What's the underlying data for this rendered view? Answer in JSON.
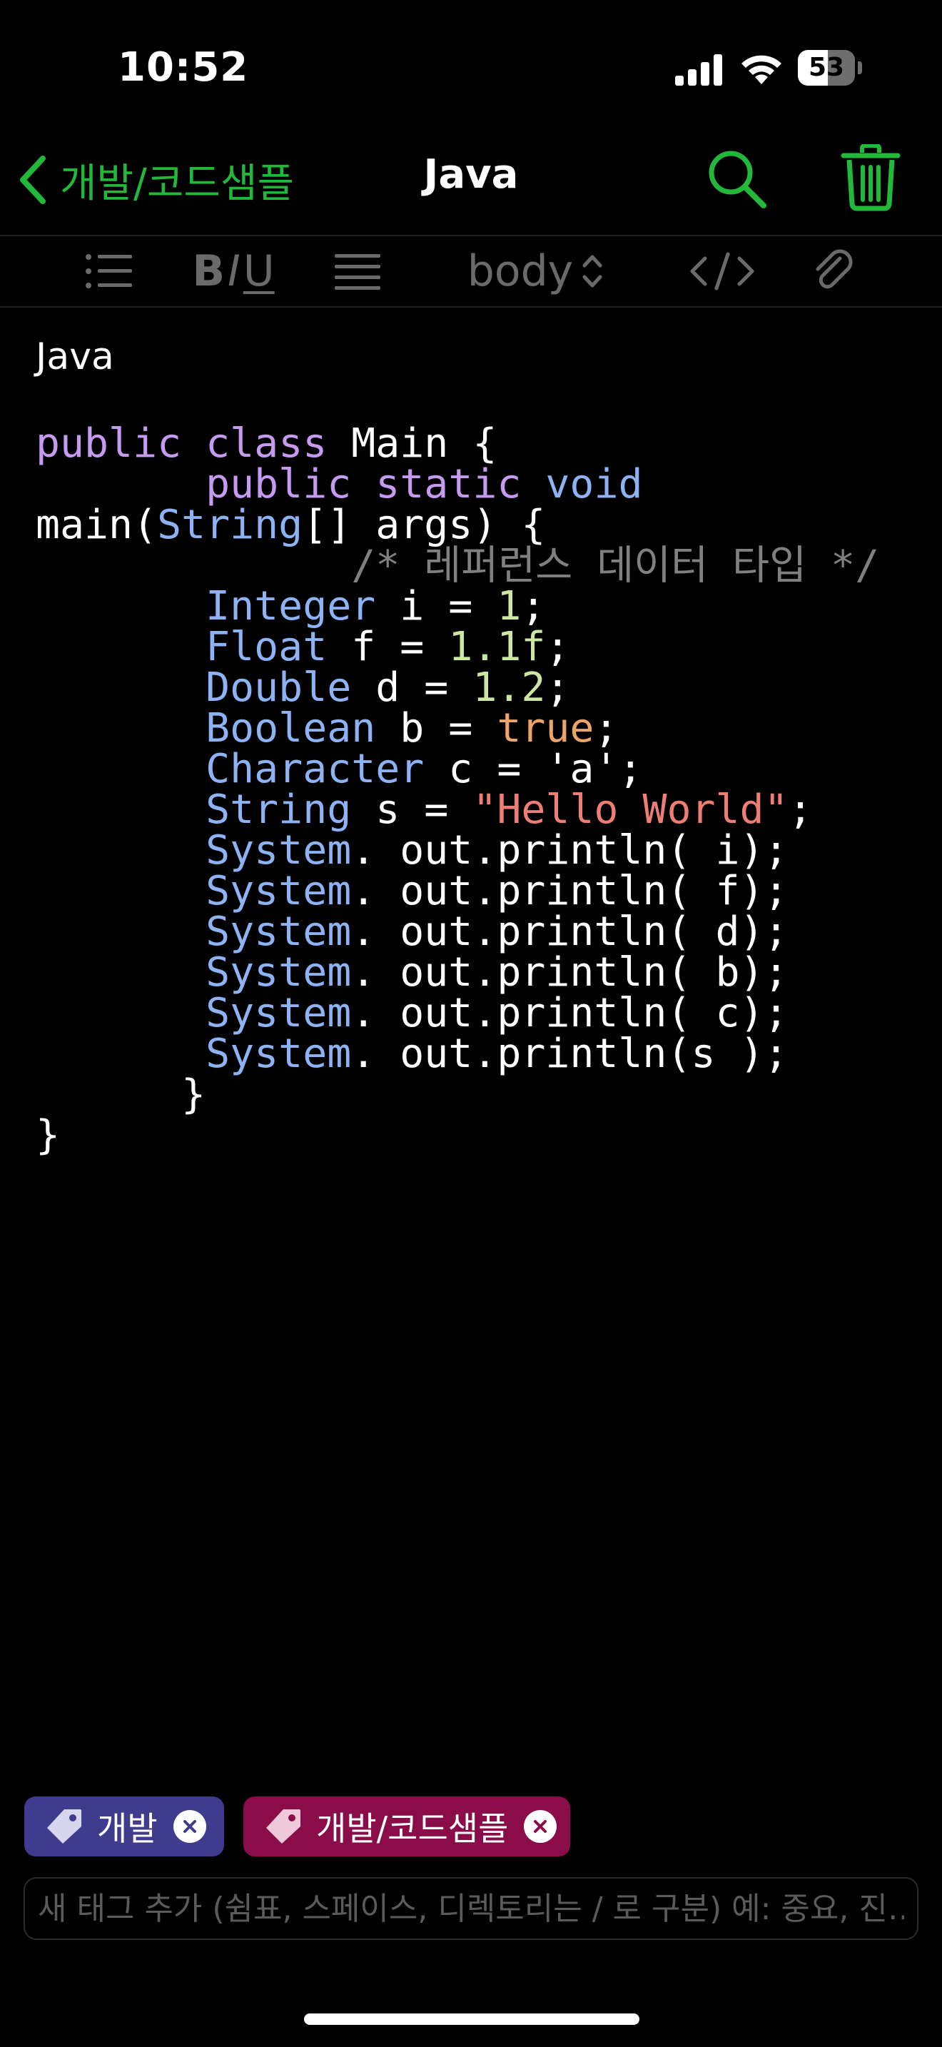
{
  "status_bar": {
    "time": "10:52",
    "battery_level": "53",
    "battery_fraction": 0.53
  },
  "nav": {
    "back_label": "개발/코드샘플",
    "title": "Java"
  },
  "toolbar": {
    "bold": "B",
    "italic": "I",
    "underline": "U",
    "text_style": "body"
  },
  "note": {
    "title": "Java",
    "code_lines": [
      [
        [
          "kw",
          "public"
        ],
        [
          "t",
          " "
        ],
        [
          "kw",
          "class"
        ],
        [
          "t",
          " Main {"
        ]
      ],
      [
        [
          "t",
          "       "
        ],
        [
          "kw",
          "public"
        ],
        [
          "t",
          " "
        ],
        [
          "kw",
          "static"
        ],
        [
          "t",
          " "
        ],
        [
          "ty",
          "void"
        ]
      ],
      [
        [
          "t",
          "main("
        ],
        [
          "ty",
          "String"
        ],
        [
          "t",
          "[] args) {"
        ]
      ],
      [
        [
          "t",
          "             "
        ],
        [
          "cm",
          "/* 레퍼런스 데이터 타입 */"
        ]
      ],
      [
        [
          "t",
          "       "
        ],
        [
          "ty",
          "Integer"
        ],
        [
          "t",
          " i = "
        ],
        [
          "nm",
          "1"
        ],
        [
          "t",
          ";"
        ]
      ],
      [
        [
          "t",
          "       "
        ],
        [
          "ty",
          "Float"
        ],
        [
          "t",
          " f = "
        ],
        [
          "nm",
          "1.1f"
        ],
        [
          "t",
          ";"
        ]
      ],
      [
        [
          "t",
          "       "
        ],
        [
          "ty",
          "Double"
        ],
        [
          "t",
          " d = "
        ],
        [
          "nm",
          "1.2"
        ],
        [
          "t",
          ";"
        ]
      ],
      [
        [
          "t",
          "       "
        ],
        [
          "ty",
          "Boolean"
        ],
        [
          "t",
          " b = "
        ],
        [
          "bo",
          "true"
        ],
        [
          "t",
          ";"
        ]
      ],
      [
        [
          "t",
          "       "
        ],
        [
          "ty",
          "Character"
        ],
        [
          "t",
          " c = 'a';"
        ]
      ],
      [
        [
          "t",
          "       "
        ],
        [
          "ty",
          "String"
        ],
        [
          "t",
          " s = "
        ],
        [
          "st",
          "\"Hello World\""
        ],
        [
          "t",
          ";"
        ]
      ],
      [
        [
          "t",
          "       "
        ],
        [
          "ty",
          "System"
        ],
        [
          "t",
          ". out.println( i);"
        ]
      ],
      [
        [
          "t",
          "       "
        ],
        [
          "ty",
          "System"
        ],
        [
          "t",
          ". out.println( f);"
        ]
      ],
      [
        [
          "t",
          "       "
        ],
        [
          "ty",
          "System"
        ],
        [
          "t",
          ". out.println( d);"
        ]
      ],
      [
        [
          "t",
          "       "
        ],
        [
          "ty",
          "System"
        ],
        [
          "t",
          ". out.println( b);"
        ]
      ],
      [
        [
          "t",
          "       "
        ],
        [
          "ty",
          "System"
        ],
        [
          "t",
          ". out.println( c);"
        ]
      ],
      [
        [
          "t",
          "       "
        ],
        [
          "ty",
          "System"
        ],
        [
          "t",
          ". out.println(s );"
        ]
      ],
      [
        [
          "t",
          "      }"
        ]
      ],
      [
        [
          "t",
          "}"
        ]
      ]
    ]
  },
  "tags": [
    {
      "label": "개발",
      "color": "#3f3b8d"
    },
    {
      "label": "개발/코드샘플",
      "color": "#8a0c49"
    }
  ],
  "tag_input": {
    "placeholder": "새 태그 추가 (쉼표, 스페이스, 디렉토리는 / 로 구분) 예: 중요, 진…",
    "value": ""
  },
  "colors": {
    "accent": "#22b83a",
    "keyword": "#c79af2",
    "type": "#8db3f4",
    "number": "#cde6a2",
    "boolean": "#eba469",
    "string": "#ee7d73",
    "comment": "#808080"
  },
  "icons": [
    "signal-icon",
    "wifi-icon",
    "battery-icon",
    "chevron-left-icon",
    "search-icon",
    "trash-icon",
    "list-icon",
    "align-icon",
    "up-down-chevron-icon",
    "code-icon",
    "paperclip-icon",
    "tag-icon",
    "close-icon"
  ]
}
